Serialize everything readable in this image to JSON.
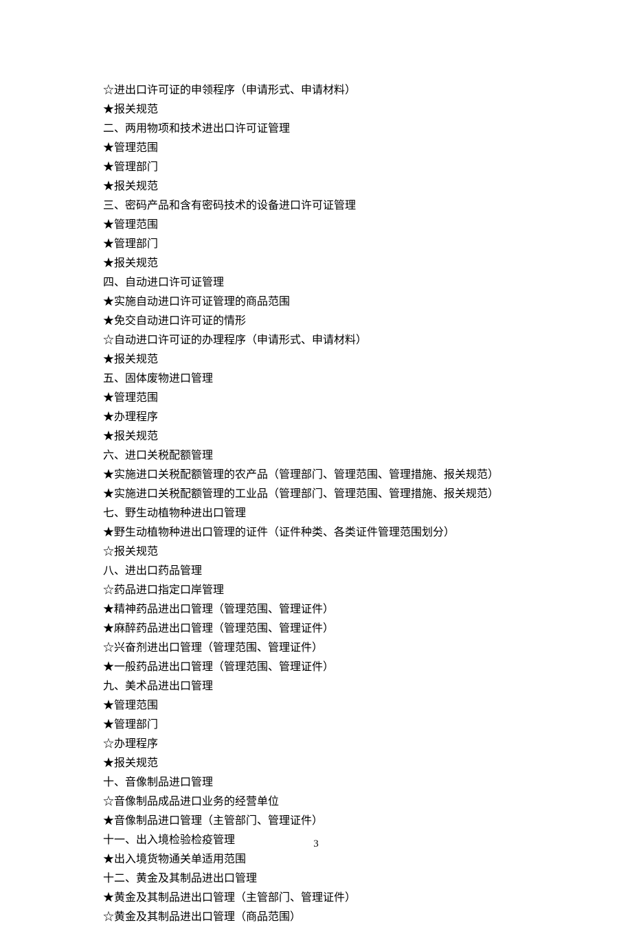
{
  "lines": [
    "☆进出口许可证的申领程序（申请形式、申请材料）",
    "★报关规范",
    "二、两用物项和技术进出口许可证管理",
    "★管理范围",
    "★管理部门",
    "★报关规范",
    "三、密码产品和含有密码技术的设备进口许可证管理",
    "★管理范围",
    "★管理部门",
    "★报关规范",
    "四、自动进口许可证管理",
    "★实施自动进口许可证管理的商品范围",
    "★免交自动进口许可证的情形",
    "☆自动进口许可证的办理程序（申请形式、申请材料）",
    "★报关规范",
    "五、固体废物进口管理",
    "★管理范围",
    "★办理程序",
    "★报关规范",
    "六、进口关税配额管理",
    "★实施进口关税配额管理的农产品（管理部门、管理范围、管理措施、报关规范）",
    "★实施进口关税配额管理的工业品（管理部门、管理范围、管理措施、报关规范）",
    "七、野生动植物种进出口管理",
    "★野生动植物种进出口管理的证件（证件种类、各类证件管理范围划分）",
    "☆报关规范",
    "八、进出口药品管理",
    "☆药品进口指定口岸管理",
    "★精神药品进出口管理（管理范围、管理证件）",
    "★麻醉药品进出口管理（管理范围、管理证件）",
    "☆兴奋剂进出口管理（管理范围、管理证件）",
    "★一般药品进出口管理（管理范围、管理证件）",
    "九、美术品进出口管理",
    "★管理范围",
    "★管理部门",
    "☆办理程序",
    "★报关规范",
    "十、音像制品进口管理",
    "☆音像制品成品进口业务的经营单位",
    "★音像制品进口管理（主管部门、管理证件）",
    "十一、出入境检验检疫管理",
    "★出入境货物通关单适用范围",
    "十二、黄金及其制品进出口管理",
    "★黄金及其制品进出口管理（主管部门、管理证件）",
    "☆黄金及其制品进出口管理（商品范围）"
  ],
  "page_number": "3"
}
